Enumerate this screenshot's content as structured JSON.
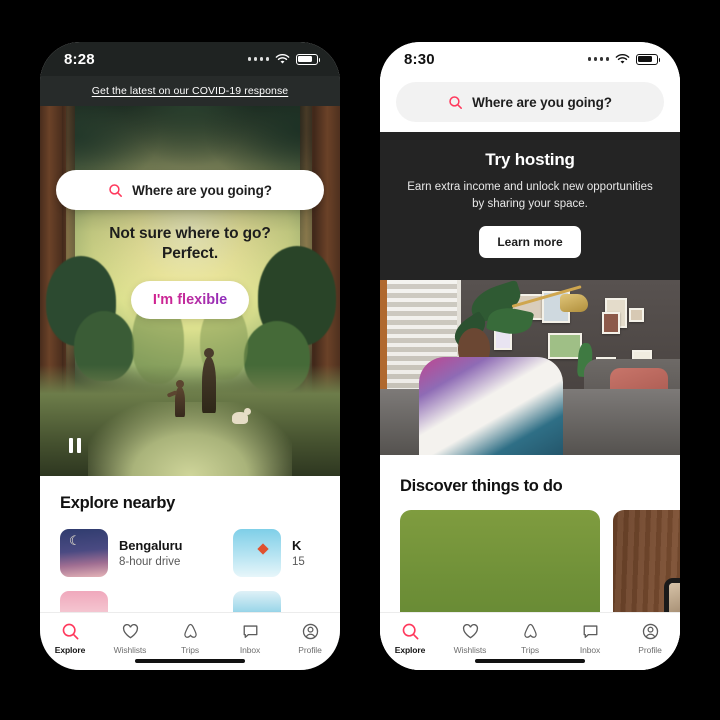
{
  "accent": {
    "brand_red": "#ff385c",
    "dark_banner": "#242424",
    "flex_gradient_start": "#d0218f",
    "flex_gradient_end": "#8b2fbe"
  },
  "phone_left": {
    "status": {
      "time": "8:28",
      "signal_icon": "signal-dots-icon",
      "wifi_icon": "wifi-icon",
      "battery_icon": "battery-icon"
    },
    "covid_banner": {
      "text": "Get the latest on our COVID-19 response"
    },
    "search": {
      "placeholder": "Where are you going?",
      "icon": "search-icon"
    },
    "hero": {
      "headline_line1": "Not sure where to go?",
      "headline_line2": "Perfect.",
      "cta_label": "I'm flexible",
      "pause_icon": "pause-icon"
    },
    "explore_nearby": {
      "title": "Explore nearby",
      "cards": [
        {
          "name": "Bengaluru",
          "distance": "8-hour drive",
          "thumb": "night-sky-thumb"
        },
        {
          "name": "K",
          "distance": "15",
          "thumb": "kite-thumb"
        },
        {
          "name": "",
          "distance": "",
          "thumb": "pink-thumb"
        },
        {
          "name": "",
          "distance": "",
          "thumb": "sea-thumb"
        }
      ]
    },
    "tabs": [
      {
        "label": "Explore",
        "icon": "search-icon",
        "active": true
      },
      {
        "label": "Wishlists",
        "icon": "heart-icon",
        "active": false
      },
      {
        "label": "Trips",
        "icon": "airbnb-belo-icon",
        "active": false
      },
      {
        "label": "Inbox",
        "icon": "message-icon",
        "active": false
      },
      {
        "label": "Profile",
        "icon": "profile-icon",
        "active": false
      }
    ]
  },
  "phone_right": {
    "status": {
      "time": "8:30",
      "signal_icon": "signal-dots-icon",
      "wifi_icon": "wifi-icon",
      "battery_icon": "battery-icon"
    },
    "search": {
      "placeholder": "Where are you going?",
      "icon": "search-icon"
    },
    "host_banner": {
      "title": "Try hosting",
      "subtitle": "Earn extra income and unlock new opportunities by sharing your space.",
      "cta_label": "Learn more"
    },
    "host_photo": {
      "alt": "host sitting on sofa in living room"
    },
    "discover": {
      "title": "Discover things to do",
      "cards": [
        {
          "alt": "sheep in green field with cheese board"
        },
        {
          "alt": "tablet video call on wooden table"
        }
      ]
    },
    "tabs": [
      {
        "label": "Explore",
        "icon": "search-icon",
        "active": true
      },
      {
        "label": "Wishlists",
        "icon": "heart-icon",
        "active": false
      },
      {
        "label": "Trips",
        "icon": "airbnb-belo-icon",
        "active": false
      },
      {
        "label": "Inbox",
        "icon": "message-icon",
        "active": false
      },
      {
        "label": "Profile",
        "icon": "profile-icon",
        "active": false
      }
    ]
  }
}
